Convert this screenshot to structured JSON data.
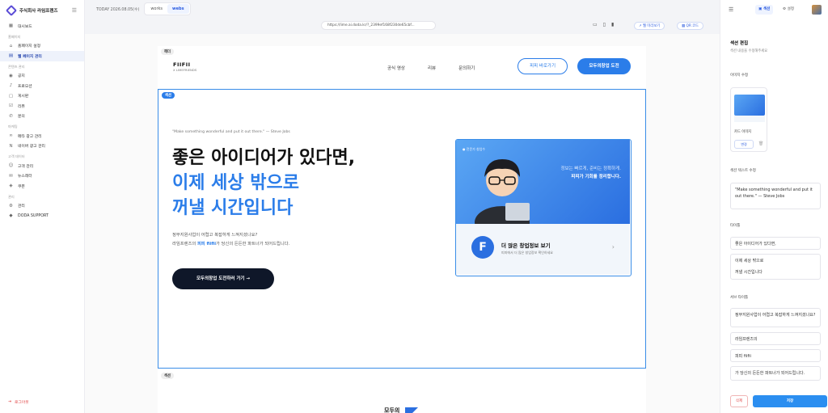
{
  "brand": {
    "name": "주식회사 라임프렌즈"
  },
  "sidebar": {
    "items": [
      {
        "label": "대시보드",
        "icon": "grid-icon",
        "active": false
      },
      {
        "group": "홈페이지"
      },
      {
        "label": "홈페이지 설정",
        "icon": "home-icon",
        "active": false
      },
      {
        "label": "웹 페이지 관리",
        "icon": "page-icon",
        "active": true
      },
      {
        "group": "콘텐츠 관리"
      },
      {
        "label": "공지",
        "icon": "megaphone-icon",
        "active": false
      },
      {
        "label": "프로모션",
        "icon": "bell-icon",
        "active": false
      },
      {
        "label": "게시판",
        "icon": "board-icon",
        "active": false
      },
      {
        "label": "리뷰",
        "icon": "review-icon",
        "active": false
      },
      {
        "label": "문의",
        "icon": "phone-icon",
        "active": false
      },
      {
        "group": "마케팅"
      },
      {
        "label": "메타 광고 관리",
        "icon": "meta-icon",
        "active": false
      },
      {
        "label": "네이버 광고 관리",
        "icon": "naver-icon",
        "active": false
      },
      {
        "group": "고객 데이터"
      },
      {
        "label": "고객 관리",
        "icon": "users-icon",
        "active": false
      },
      {
        "label": "뉴스레터",
        "icon": "mail-icon",
        "active": false
      },
      {
        "label": "쿠폰",
        "icon": "coupon-icon",
        "active": false
      },
      {
        "group": "관리"
      },
      {
        "label": "관리",
        "icon": "gear-icon",
        "active": false
      },
      {
        "label": "DODA SUPPORT",
        "icon": "support-icon",
        "active": false
      }
    ],
    "logout": "로그아웃"
  },
  "topbar": {
    "today": "TODAY 2026.08.05(수)",
    "tabs": [
      "works",
      "webs"
    ],
    "active_tab": "webs"
  },
  "urlbar": {
    "url": "https://lime.ai.doda.kr/?_2399ef168f230de65cbf...",
    "preview_label": "웹 미리보기",
    "qr_label": "QR 코드"
  },
  "page": {
    "header_tag": "헤더",
    "logo_main": "FIIFII",
    "logo_sub": "X LIMEFRIENDS",
    "nav": [
      "공식 영상",
      "리뷰",
      "문의하기"
    ],
    "btn_outline": "피피 바로가기",
    "btn_primary": "모두의창업 도전",
    "section_tag": "섹션",
    "quote": "\"Make something wonderful and put it out there.\" — Steve Jobs",
    "title_line1": "좋은 아이디어가 있다면,",
    "title_line2": "이제 세상 밖으로",
    "title_line3": "꺼낼 시간입니다",
    "sub_line1": "정부지원사업이 어렵고 복잡하게 느껴지셨나요?",
    "sub_line2_pre": "라임프렌즈의 ",
    "sub_line2_hl": "피피 fiifii",
    "sub_line2_post": "가 당신의 든든한 파트너가 되어드립니다.",
    "cta": "모두의창업 도전하러 가기 →",
    "card": {
      "badge": "● 전문가 창업수",
      "text1": "정보는 빠르게, 준비는 정확하게.",
      "text2": "피피가 기회를 정리합니다.",
      "f_letter": "F",
      "title": "더 많은 창업정보 보기",
      "sub": "피피에서 더 많은 창업정보 확인하세요",
      "arrow": "›"
    },
    "section2_tag": "섹션",
    "logo2": "모두의\n창업"
  },
  "panel": {
    "tabs": [
      "섹션",
      "설정"
    ],
    "title": "섹션 편집",
    "subtitle": "섹션 내용을 수정해주세요",
    "image_label": "이미지 수정",
    "card_image_label": "카드 이미지",
    "change_btn": "변경",
    "text_label": "섹션 텍스트 수정",
    "quote_value": "\"Make something wonderful and put it out there.\" — Steve Jobs",
    "title_label": "타이틀",
    "title_value1": "좋은 아이디어가 있다면,",
    "title_value2": "이제 세상 밖으로",
    "title_value3": "꺼낼 시간입니다",
    "subtitle_label": "서브 타이틀",
    "sub_value1": "정부지원사업이 어렵고 복잡하게 느껴지셨나요?",
    "sub_value2": "라임프렌즈의",
    "sub_value3": "피피 fiifii",
    "sub_value4": "가 당신의 든든한 파트너가 되어드립니다.",
    "delete_btn": "삭제",
    "save_btn": "저장"
  }
}
